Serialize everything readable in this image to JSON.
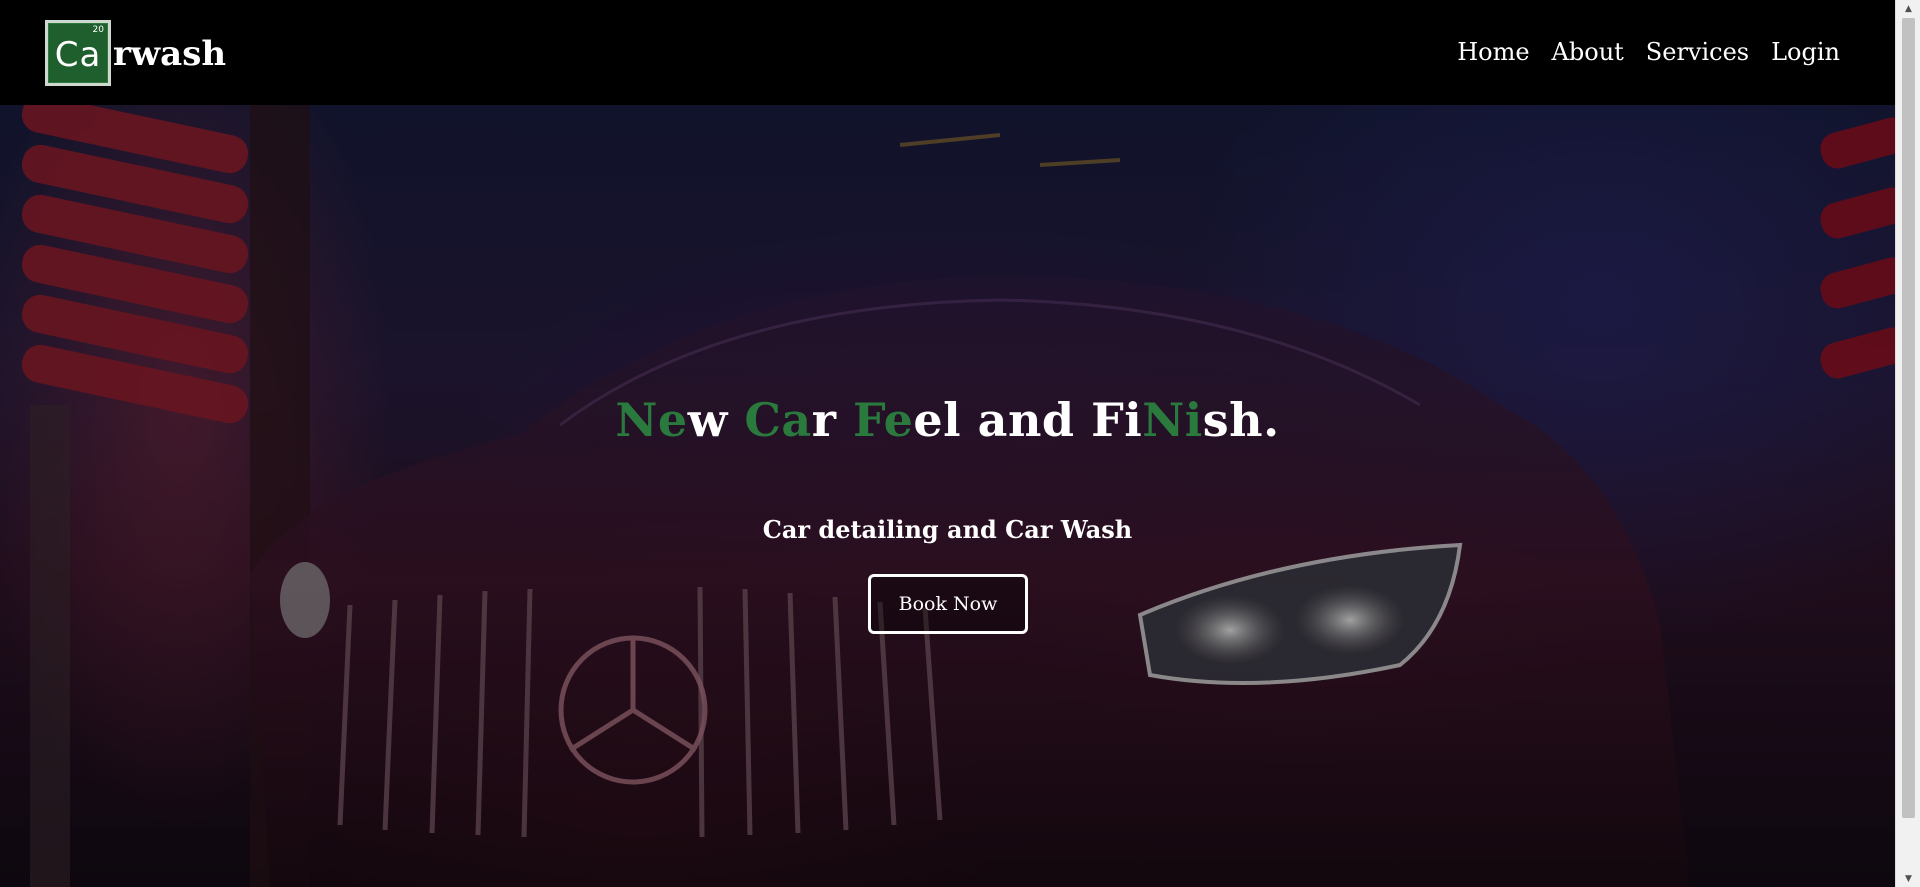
{
  "brand": {
    "element_symbol": "Ca",
    "element_number": "20",
    "name_rest": "rwash",
    "tile_color": "#1f5f2e"
  },
  "nav": {
    "items": [
      {
        "label": "Home"
      },
      {
        "label": "About"
      },
      {
        "label": "Services"
      },
      {
        "label": "Login"
      }
    ]
  },
  "hero": {
    "headline_segments": [
      {
        "text": "Ne",
        "color": "green"
      },
      {
        "text": "w ",
        "color": "white"
      },
      {
        "text": "Ca",
        "color": "green"
      },
      {
        "text": "r ",
        "color": "white"
      },
      {
        "text": "Fe",
        "color": "green"
      },
      {
        "text": "el and Fi",
        "color": "white"
      },
      {
        "text": "Ni",
        "color": "green"
      },
      {
        "text": "sh.",
        "color": "white"
      }
    ],
    "subtitle": "Car detailing and Car Wash",
    "cta_label": "Book Now",
    "accent_color": "#2a7a3e"
  }
}
